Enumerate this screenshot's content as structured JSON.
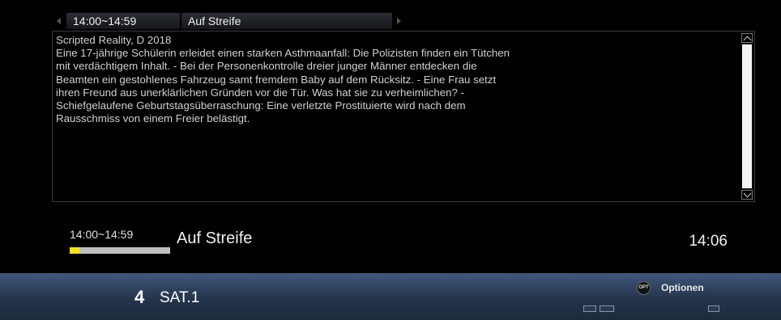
{
  "epg_header": {
    "time": "14:00~14:59",
    "title": "Auf Streife"
  },
  "description": {
    "lines": [
      "Scripted Reality, D 2018",
      "Eine 17-jährige Schülerin erleidet einen starken Asthmaanfall: Die Polizisten finden ein Tütchen",
      "mit verdächtigem Inhalt. - Bei der Personenkontrolle dreier junger Männer entdecken die",
      "Beamten ein gestohlenes Fahrzeug samt fremdem Baby auf dem Rücksitz. - Eine Frau setzt",
      "ihren Freund aus unerklärlichen Gründen vor die Tür. Was hat sie zu verheimlichen? -",
      "Schiefgelaufene Geburtstagsüberraschung: Eine verletzte Prostituierte wird nach dem",
      "Rausschmiss von einem Freier belästigt."
    ]
  },
  "now_playing": {
    "time": "14:00~14:59",
    "title": "Auf Streife",
    "progress_fraction": 0.1
  },
  "clock": "14:06",
  "channel": {
    "number": "4",
    "name": "SAT.1"
  },
  "options": {
    "icon_text": "OPT",
    "label": "Optionen"
  },
  "colors": {
    "progress_fill": "#f5e21a",
    "footer": "#2c3f5a"
  }
}
